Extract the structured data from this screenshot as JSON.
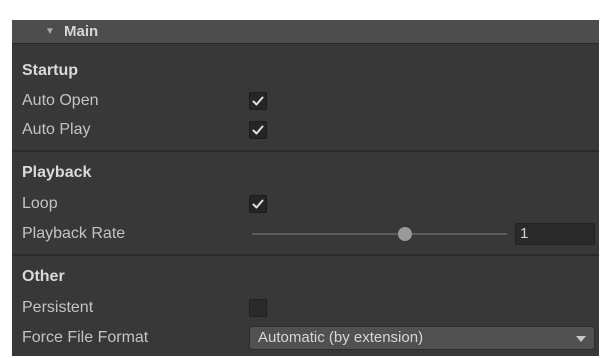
{
  "header": {
    "title": "Main",
    "toggle_icon": "triangle-down-icon"
  },
  "sections": {
    "startup": {
      "label": "Startup",
      "auto_open": {
        "label": "Auto Open",
        "checked": true
      },
      "auto_play": {
        "label": "Auto Play",
        "checked": true
      }
    },
    "playback": {
      "label": "Playback",
      "loop": {
        "label": "Loop",
        "checked": true
      },
      "rate": {
        "label": "Playback Rate",
        "value": "1",
        "slider_fraction": 0.6
      }
    },
    "other": {
      "label": "Other",
      "persistent": {
        "label": "Persistent",
        "checked": false
      },
      "force_format": {
        "label": "Force File Format",
        "selected": "Automatic (by extension)"
      }
    }
  },
  "colors": {
    "panel_bg": "#383838",
    "header_bg": "#4d4d4d",
    "text": "#c4c4c4",
    "field_bg": "#2a2a2a",
    "dropdown_bg": "#515151"
  }
}
